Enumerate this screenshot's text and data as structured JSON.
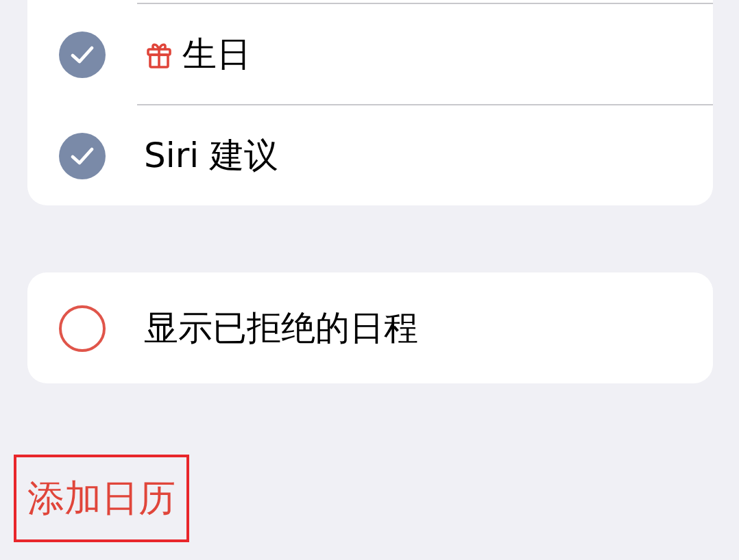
{
  "calendars": [
    {
      "label": "生日",
      "checked": true,
      "kind": "birthday"
    },
    {
      "label": "Siri 建议",
      "checked": true,
      "kind": "plain"
    }
  ],
  "declined_option": {
    "label": "显示已拒绝的日程",
    "checked": false
  },
  "add_calendar": {
    "label": "添加日历",
    "highlighted": true
  }
}
